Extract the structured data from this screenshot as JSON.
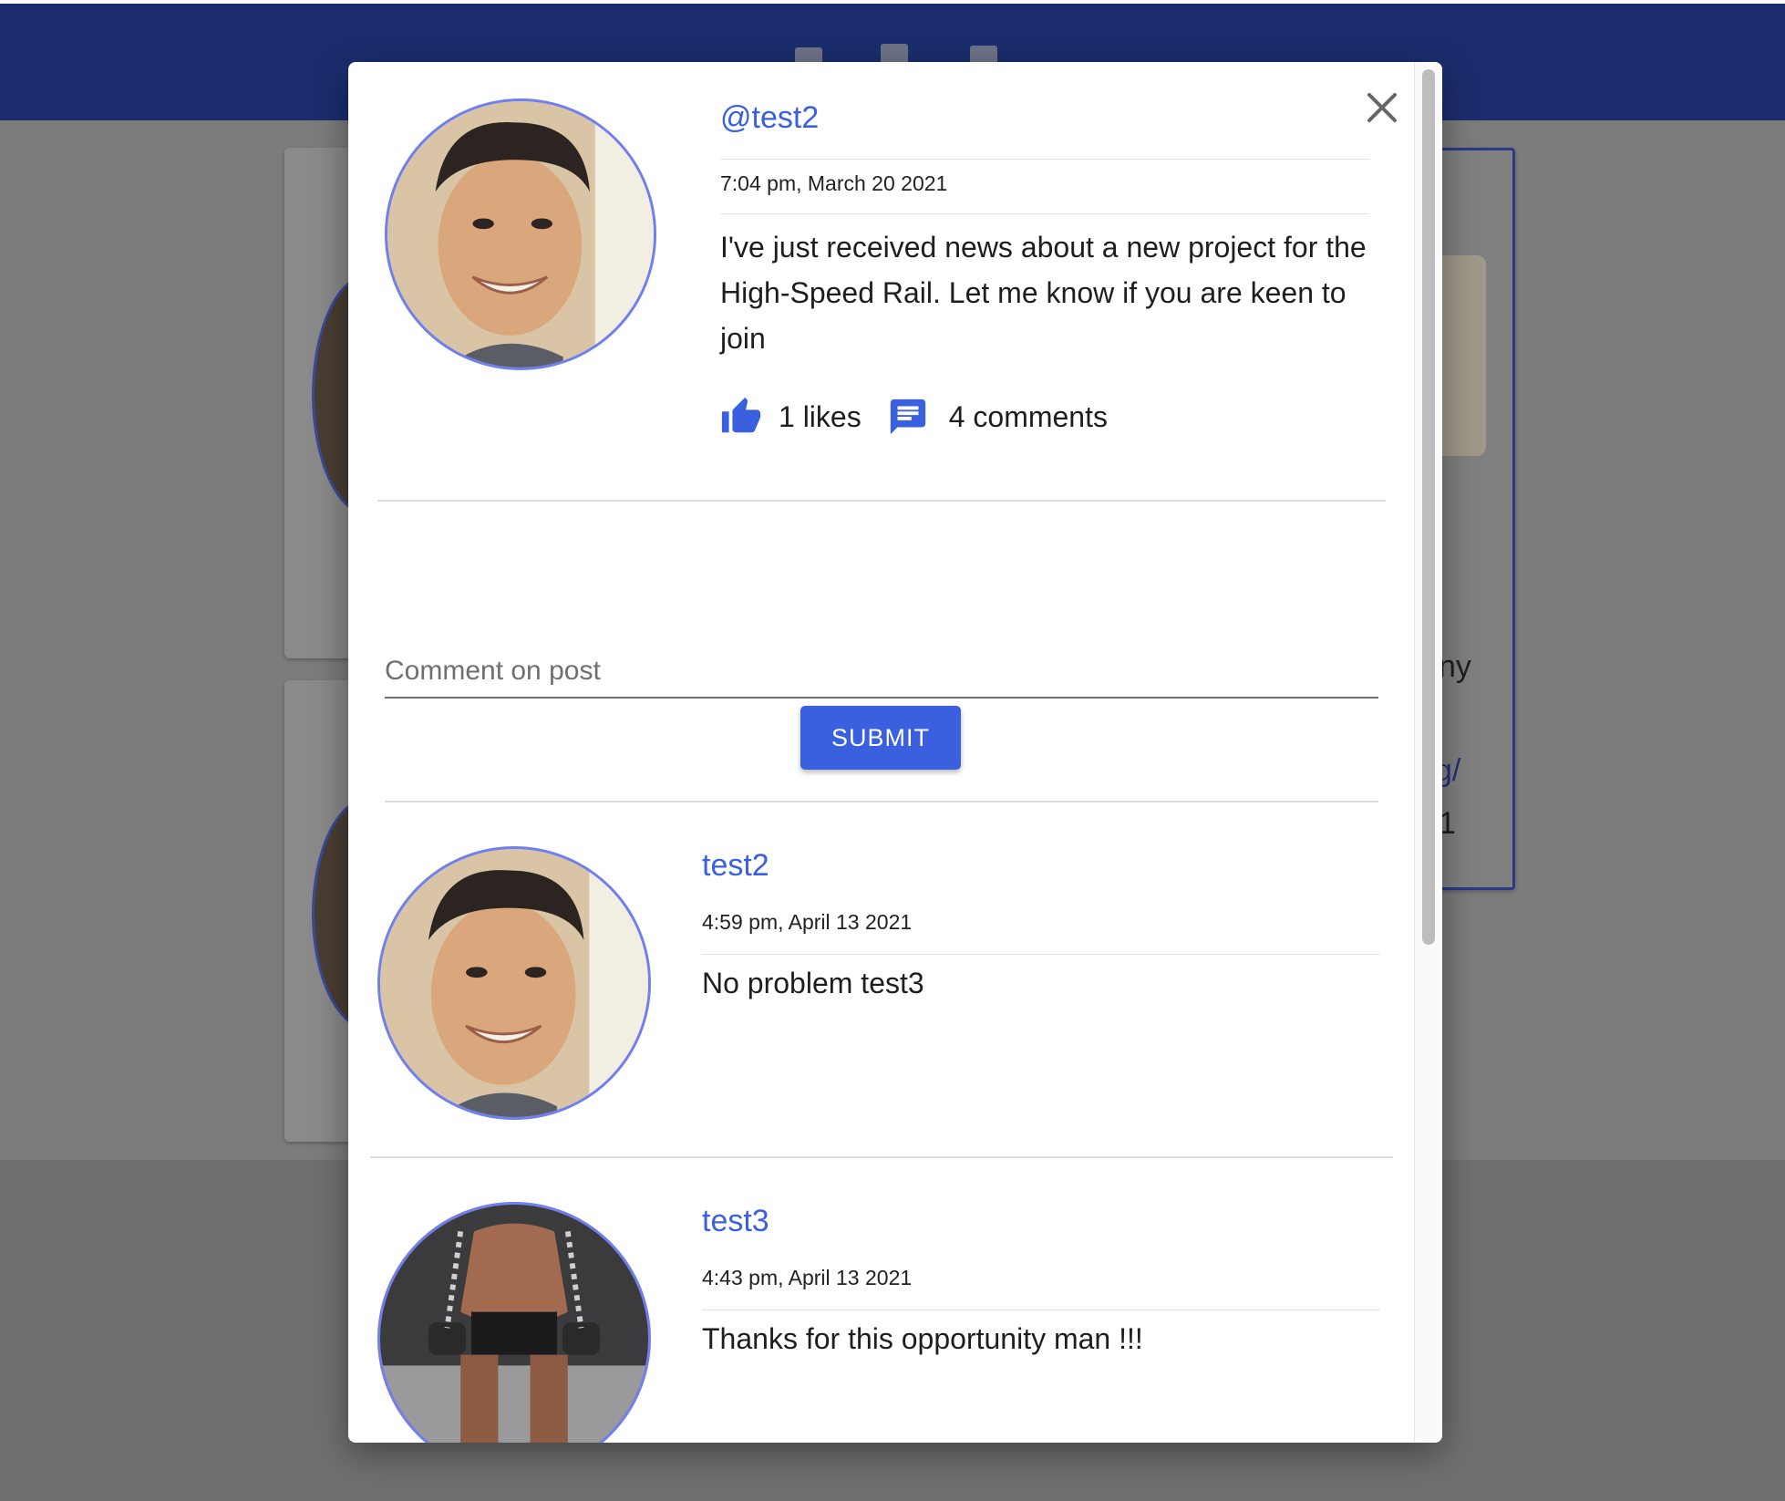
{
  "post": {
    "username": "@test2",
    "timestamp": "7:04 pm, March 20 2021",
    "body": "I've just received news about a new project for the High-Speed Rail. Let me know if you are keen to join",
    "likes": "1 likes",
    "comments": "4 comments"
  },
  "comment_form": {
    "placeholder": "Comment on post",
    "value": "",
    "submit_label": "SUBMIT"
  },
  "comments": [
    {
      "username": "test2",
      "timestamp": "4:59 pm, April 13 2021",
      "body": "No problem test3"
    },
    {
      "username": "test3",
      "timestamp": "4:43 pm, April 13 2021",
      "body": "Thanks for this opportunity man !!!"
    }
  ],
  "background": {
    "right_card_fragments": [
      "ny",
      "g/",
      "1"
    ]
  },
  "icons": {
    "close": "close-icon",
    "like": "thumbs-up-icon",
    "comment": "comment-icon"
  },
  "colors": {
    "appbar": "#1b2d6e",
    "accent": "#3a60e0",
    "avatar_ring": "#6f7ef2"
  }
}
